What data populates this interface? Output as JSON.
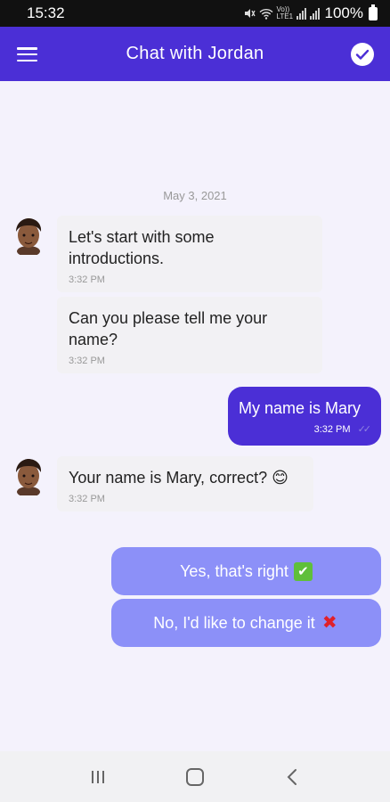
{
  "status": {
    "time": "15:32",
    "battery": "100%",
    "net_label": "Vo)) LTE1"
  },
  "header": {
    "title": "Chat with Jordan"
  },
  "chat": {
    "date": "May 3, 2021",
    "messages": [
      {
        "from": "bot",
        "text": "Let's start with some introductions.",
        "time": "3:32 PM"
      },
      {
        "from": "bot",
        "text": "Can you please tell me your name?",
        "time": "3:32 PM"
      },
      {
        "from": "user",
        "text": "My name is Mary",
        "time": "3:32 PM"
      },
      {
        "from": "bot",
        "text": "Your name is Mary, correct?",
        "emoji": "😊",
        "time": "3:32 PM"
      }
    ]
  },
  "quick_replies": [
    {
      "label": "Yes, that's right",
      "emoji": "✔"
    },
    {
      "label": "No, I'd like to change it",
      "emoji": "✖"
    }
  ],
  "colors": {
    "primary": "#4b2fd6",
    "quick_reply": "#8c90f8",
    "background": "#f4f2fc"
  }
}
